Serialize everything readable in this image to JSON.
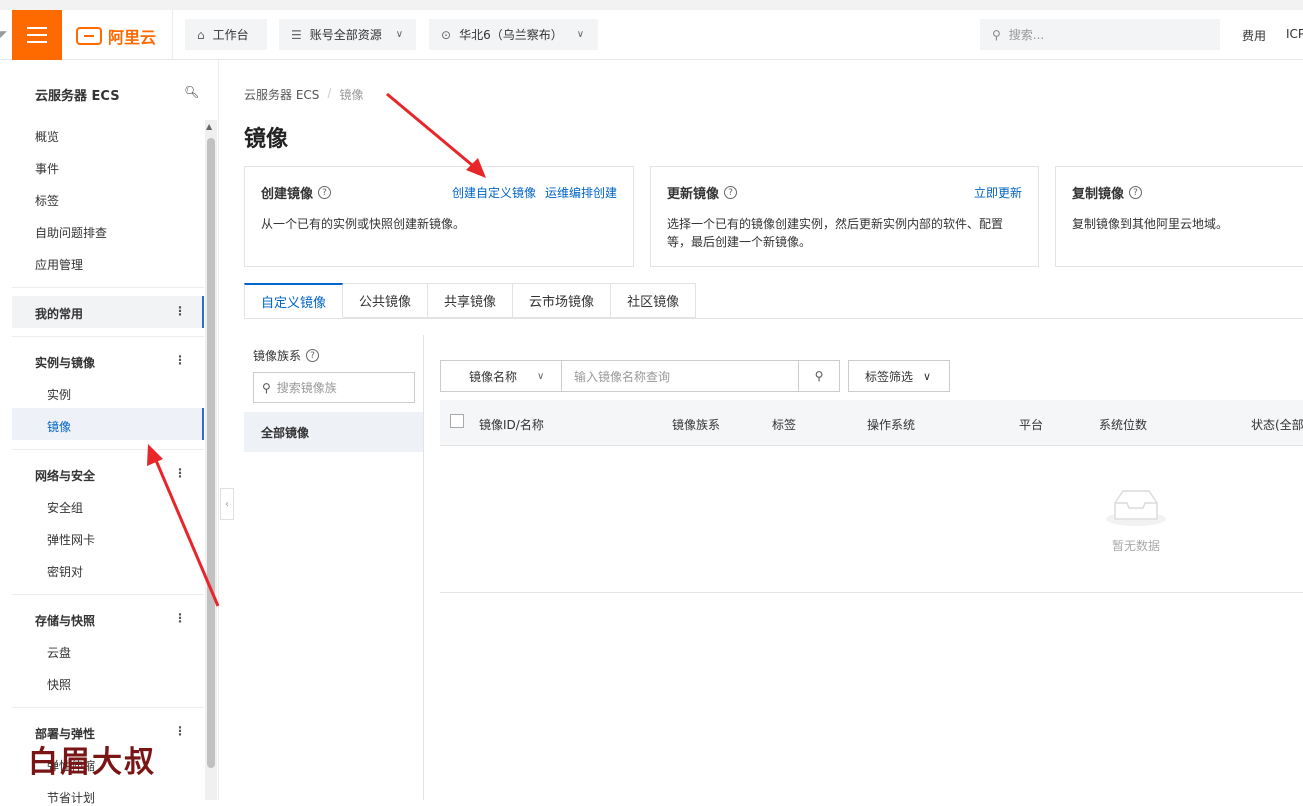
{
  "topbar": {
    "brand": "阿里云",
    "workbench": "工作台",
    "resources": "账号全部资源",
    "region": "华北6（乌兰察布）",
    "search_placeholder": "搜索...",
    "fee": "费用",
    "icp": "ICP"
  },
  "sidebar": {
    "title": "云服务器 ECS",
    "items": [
      "概览",
      "事件",
      "标签",
      "自助问题排查",
      "应用管理"
    ],
    "favorites": "我的常用",
    "groups": [
      {
        "label": "实例与镜像",
        "children": [
          "实例",
          "镜像"
        ]
      },
      {
        "label": "网络与安全",
        "children": [
          "安全组",
          "弹性网卡",
          "密钥对"
        ]
      },
      {
        "label": "存储与快照",
        "children": [
          "云盘",
          "快照"
        ]
      },
      {
        "label": "部署与弹性",
        "children": [
          "弹性伸缩",
          "节省计划"
        ]
      }
    ]
  },
  "watermark": "白眉大叔",
  "breadcrumb": {
    "root": "云服务器 ECS",
    "current": "镜像"
  },
  "page_title": "镜像",
  "cards": [
    {
      "title": "创建镜像",
      "links": [
        "创建自定义镜像",
        "运维编排创建"
      ],
      "desc": "从一个已有的实例或快照创建新镜像。"
    },
    {
      "title": "更新镜像",
      "links": [
        "立即更新"
      ],
      "desc": "选择一个已有的镜像创建实例，然后更新实例内部的软件、配置等，最后创建一个新镜像。",
      "desc_line1": "选择一个已有的镜像创建实例，然后更新实例内部的软件、配置",
      "desc_line2": "等，最后创建一个新镜像。"
    },
    {
      "title": "复制镜像",
      "links": [],
      "desc": "复制镜像到其他阿里云地域。"
    }
  ],
  "tabs": [
    "自定义镜像",
    "公共镜像",
    "共享镜像",
    "云市场镜像",
    "社区镜像"
  ],
  "family": {
    "title": "镜像族系",
    "search_placeholder": "搜索镜像族",
    "all": "全部镜像"
  },
  "filter": {
    "select": "镜像名称",
    "input_placeholder": "输入镜像名称查询",
    "tag_filter": "标签筛选"
  },
  "table": {
    "columns": [
      "镜像ID/名称",
      "镜像族系",
      "标签",
      "操作系统",
      "平台",
      "系统位数",
      "状态(全部)"
    ],
    "empty": "暂无数据"
  },
  "colors": {
    "brand": "#ff6a00",
    "link": "#0064c8",
    "arrow": "#e8262a"
  }
}
